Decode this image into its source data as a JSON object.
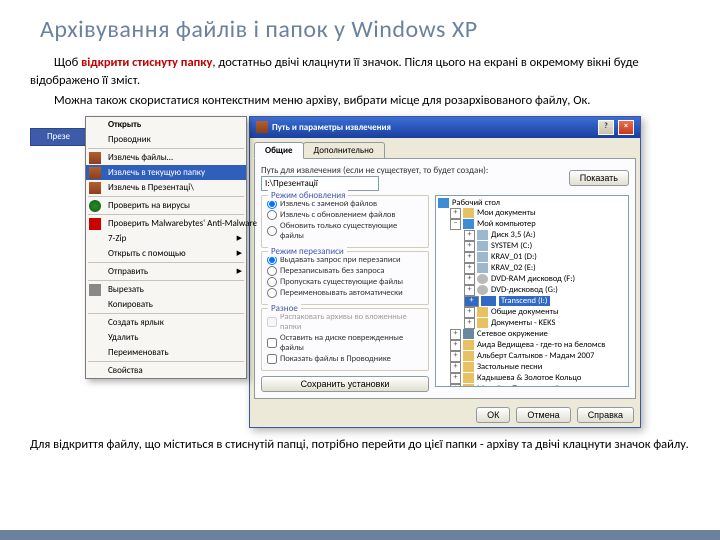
{
  "title": "Архівування файлів і папок у Windows XP",
  "para1_prefix": "Щоб ",
  "para1_red": "відкрити стиснуту папку",
  "para1_rest": ", достатньо двічі клацнути її значок. Після цього на екрані в окремому вікні буде відображено її зміст.",
  "para2": "Можна також скористатися контекстним меню архіву, вибрати місце для розархівованого файлу, Ок.",
  "footer_text": "Для відкриття файлу, що міститься в стиснутій папці, потрібно перейти до цієї папки - архіву та двічі клацнути значок файлу.",
  "folder_label": "Презе",
  "ctx": {
    "open": "Открыть",
    "explorer": "Проводник",
    "extract_files": "Извлечь файлы…",
    "extract_here": "Извлечь в текущую папку",
    "extract_to": "Извлечь в Презентаці\\",
    "scan": "Проверить на вирусы",
    "malware": "Проверить Malwarebytes' Anti-Malware",
    "sevenzip": "7-Zip",
    "open_with": "Открыть с помощью",
    "send_to": "Отправить",
    "cut": "Вырезать",
    "copy": "Копировать",
    "shortcut": "Создать ярлык",
    "delete": "Удалить",
    "rename": "Переименовать",
    "props": "Свойства"
  },
  "dlg": {
    "title": "Путь и параметры извлечения",
    "tab_general": "Общие",
    "tab_extra": "Дополнительно",
    "path_label": "Путь для извлечения (если не существует, то будет создан):",
    "path_value": "І:\\Презентації",
    "show_btn": "Показать",
    "grp_update": "Режим обновления",
    "upd_replace": "Извлечь с заменой файлов",
    "upd_update": "Извлечь с обновлением файлов",
    "upd_fresh": "Обновить только существующие файлы",
    "grp_overwrite": "Режим перезаписи",
    "ow_ask": "Выдавать запрос при перезаписи",
    "ow_noask": "Перезаписывать без запроса",
    "ow_skip": "Пропускать существующие файлы",
    "ow_rename": "Переименовывать автоматически",
    "grp_misc": "Разное",
    "misc_nest": "Распаковать архивы во вложенные папки",
    "misc_keep": "Оставить на диске поврежденные файлы",
    "misc_show": "Показать файлы в Проводнике",
    "save_btn": "Сохранить установки",
    "tree": {
      "desktop": "Рабочий стол",
      "mydocs": "Мои документы",
      "mycomp": "Мой компьютер",
      "disk_a": "Диск 3,5 (A:)",
      "disk_c": "SYSTEM (C:)",
      "disk_d": "KRAV_01 (D:)",
      "disk_e": "KRAV_02 (E:)",
      "disk_f": "DVD-RAM дисковод (F:)",
      "disk_g": "DVD-дисковод (G:)",
      "disk_i": "Transcend (I:)",
      "shared": "Общие документы",
      "keks": "Документы - KEKS",
      "network": "Сетевое окружение",
      "f1": "Аида Ведищева - где-то на беломсв",
      "f2": "Альберт Салтыков - Мадам 2007",
      "f3": "Застольные песни",
      "f4": "Кадышева & Золотое Кольцо",
      "f5": "Михайло Поплавський"
    },
    "ok": "ОК",
    "cancel": "Отмена",
    "help": "Справка"
  }
}
